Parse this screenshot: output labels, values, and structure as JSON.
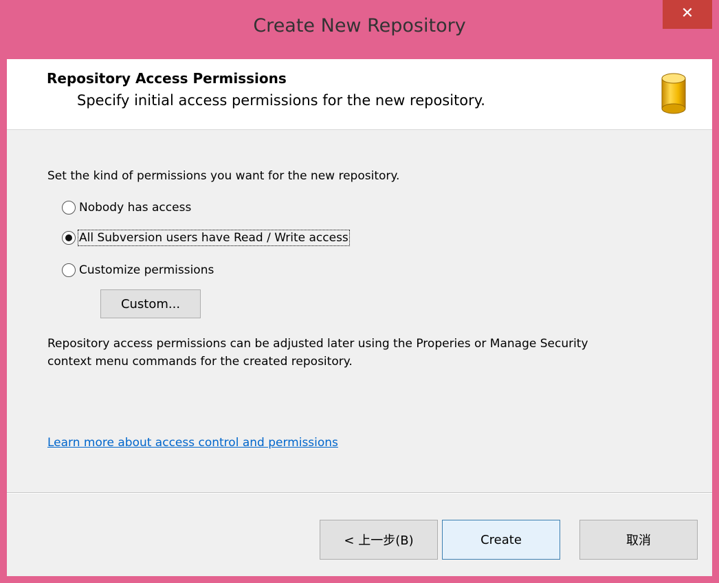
{
  "window": {
    "title": "Create New Repository",
    "close_glyph": "✕"
  },
  "header": {
    "title": "Repository Access Permissions",
    "subtitle": "Specify initial access permissions for the new repository.",
    "icon": "database-icon"
  },
  "main": {
    "instruction": "Set the kind of permissions you want for the new repository.",
    "options": [
      {
        "label": "Nobody has access",
        "selected": false
      },
      {
        "label": "All Subversion users have Read / Write access",
        "selected": true
      },
      {
        "label": "Customize permissions",
        "selected": false
      }
    ],
    "custom_button": "Custom...",
    "note_line1": "Repository access permissions can be adjusted later using the Properies or Manage Security",
    "note_line2": "context menu commands for the created repository.",
    "link": "Learn more about access control and permissions"
  },
  "footer": {
    "back_button": "< 上一步(B)",
    "create_button": "Create",
    "cancel_button": "取消"
  },
  "colors": {
    "titlebar": "#e3628f",
    "close": "#c7403a",
    "link": "#0066cc",
    "icon_gold": "#e6b422"
  }
}
